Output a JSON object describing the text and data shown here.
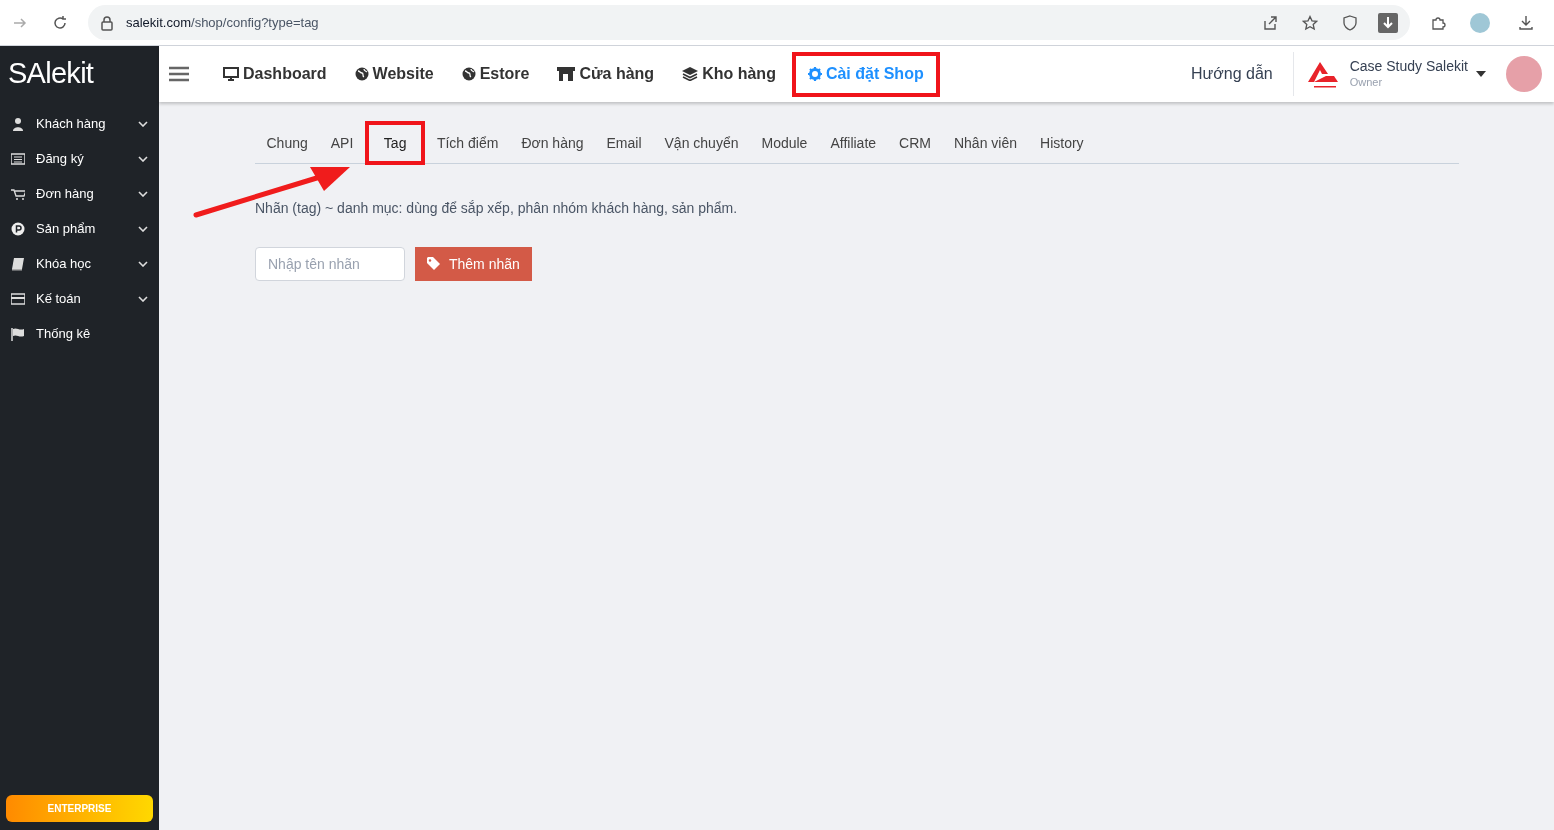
{
  "browser": {
    "url_host": "salekit.com",
    "url_path": "/shop/config?type=tag"
  },
  "logo": "SAlekit",
  "nav": [
    {
      "label": "Dashboard",
      "active": false,
      "highlighted": false
    },
    {
      "label": "Website",
      "active": false,
      "highlighted": false
    },
    {
      "label": "Estore",
      "active": false,
      "highlighted": false
    },
    {
      "label": "Cửa hàng",
      "active": false,
      "highlighted": false
    },
    {
      "label": "Kho hàng",
      "active": false,
      "highlighted": false
    },
    {
      "label": "Cài đặt Shop",
      "active": true,
      "highlighted": true
    }
  ],
  "header_right": {
    "guide": "Hướng dẫn",
    "account_name": "Case Study Salekit",
    "account_role": "Owner"
  },
  "sidebar": {
    "items": [
      {
        "label": "Khách hàng",
        "expandable": true
      },
      {
        "label": "Đăng ký",
        "expandable": true
      },
      {
        "label": "Đơn hàng",
        "expandable": true
      },
      {
        "label": "Sản phẩm",
        "expandable": true
      },
      {
        "label": "Khóa học",
        "expandable": true
      },
      {
        "label": "Kế toán",
        "expandable": true
      },
      {
        "label": "Thống kê",
        "expandable": false
      }
    ],
    "plan_badge": "ENTERPRISE"
  },
  "tabs": [
    {
      "label": "Chung",
      "selected": false,
      "highlighted": false
    },
    {
      "label": "API",
      "selected": false,
      "highlighted": false
    },
    {
      "label": "Tag",
      "selected": true,
      "highlighted": true
    },
    {
      "label": "Tích điểm",
      "selected": false,
      "highlighted": false
    },
    {
      "label": "Đơn hàng",
      "selected": false,
      "highlighted": false
    },
    {
      "label": "Email",
      "selected": false,
      "highlighted": false
    },
    {
      "label": "Vận chuyển",
      "selected": false,
      "highlighted": false
    },
    {
      "label": "Module",
      "selected": false,
      "highlighted": false
    },
    {
      "label": "Affiliate",
      "selected": false,
      "highlighted": false
    },
    {
      "label": "CRM",
      "selected": false,
      "highlighted": false
    },
    {
      "label": "Nhân viên",
      "selected": false,
      "highlighted": false
    },
    {
      "label": "History",
      "selected": false,
      "highlighted": false
    }
  ],
  "description": "Nhãn (tag) ~ danh mục: dùng để sắp xếp, phân nhóm khách hàng, sản phẩm.",
  "tag_form": {
    "placeholder": "Nhập tên nhãn",
    "button": "Thêm nhãn"
  }
}
